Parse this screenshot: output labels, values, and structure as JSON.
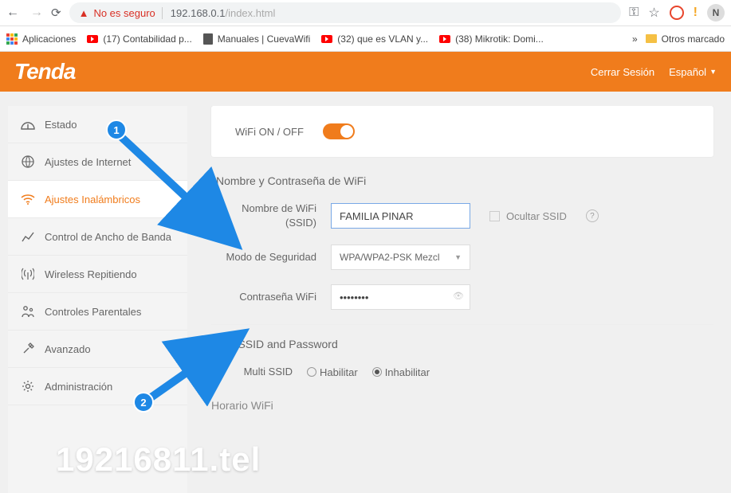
{
  "browser": {
    "insecure_label": "No es seguro",
    "url_host": "192.168.0.1",
    "url_path": "/index.html",
    "profile_initial": "N"
  },
  "bookmarks": {
    "apps_label": "Aplicaciones",
    "items": [
      "(17) Contabilidad p...",
      "Manuales | CuevaWifi",
      "(32) que es VLAN y...",
      "(38) Mikrotik: Domi..."
    ],
    "more_glyph": "»",
    "other_label": "Otros marcado"
  },
  "header": {
    "brand": "Tenda",
    "logout": "Cerrar Sesión",
    "language": "Español"
  },
  "sidebar": {
    "items": [
      {
        "label": "Estado"
      },
      {
        "label": "Ajustes de Internet"
      },
      {
        "label": "Ajustes Inalámbricos"
      },
      {
        "label": "Control de Ancho de Banda"
      },
      {
        "label": "Wireless Repitiendo"
      },
      {
        "label": "Controles Parentales"
      },
      {
        "label": "Avanzado"
      },
      {
        "label": "Administración"
      }
    ]
  },
  "wifi": {
    "onoff_label": "WiFi ON / OFF",
    "section_title": "Nombre y Contraseña de WiFi",
    "ssid_label": "Nombre de WiFi (SSID)",
    "ssid_value": "FAMILIA PINAR",
    "hide_ssid_label": "Ocultar SSID",
    "security_label": "Modo de Seguridad",
    "security_value": "WPA/WPA2-PSK Mezcl",
    "password_label": "Contraseña WiFi",
    "password_value": "••••••••",
    "multi_title": "Multi SSID and Password",
    "multi_label": "Multi SSID",
    "enable_label": "Habilitar",
    "disable_label": "Inhabilitar",
    "schedule_title": "Horario WiFi"
  },
  "annotations": {
    "badge1": "1",
    "badge2": "2"
  },
  "watermark": "19216811.tel"
}
